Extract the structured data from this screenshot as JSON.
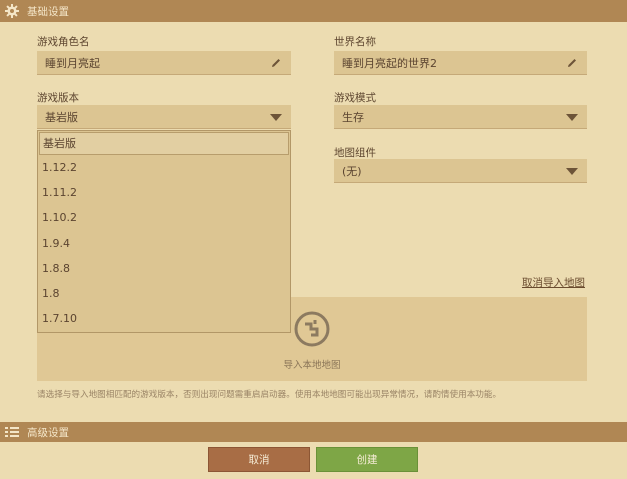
{
  "basic_section": {
    "title": "基础设置",
    "icon": "gear-icon"
  },
  "player_name": {
    "label": "游戏角色名",
    "value": "睡到月亮起",
    "icon": "pencil-icon"
  },
  "world_name": {
    "label": "世界名称",
    "value": "睡到月亮起的世界2",
    "icon": "pencil-icon"
  },
  "game_version": {
    "label": "游戏版本",
    "selected": "基岩版",
    "options": [
      "基岩版",
      "1.12.2",
      "1.11.2",
      "1.10.2",
      "1.9.4",
      "1.8.8",
      "1.8",
      "1.7.10"
    ]
  },
  "game_mode": {
    "label": "游戏模式",
    "value": "生存"
  },
  "map_component": {
    "label": "地图组件",
    "value": "(无)"
  },
  "import": {
    "cancel_link": "取消导入地图",
    "drop_label": "导入本地地图",
    "hint": "请选择与导入地图相匹配的游戏版本，否则出现问题需重启启动器。使用本地地图可能出现异常情况，请酌情使用本功能。"
  },
  "advanced_section": {
    "title": "高级设置",
    "icon": "list-icon"
  },
  "buttons": {
    "cancel": "取消",
    "create": "创建"
  },
  "colors": {
    "header_bar": "#b08754",
    "background": "#ecdcb1",
    "cancel_button": "#a86d45",
    "create_button": "#7ea646"
  }
}
